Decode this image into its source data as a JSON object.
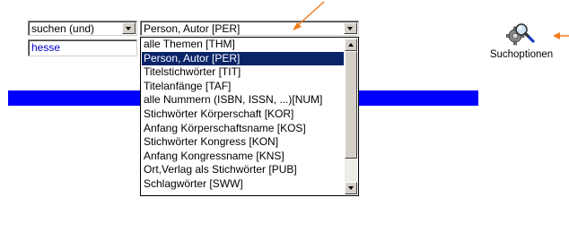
{
  "search_form": {
    "operator_select": {
      "selected": "suchen (und)"
    },
    "field_select": {
      "selected": "Person, Autor [PER]",
      "options": [
        "alle Themen [THM]",
        "Person, Autor [PER]",
        "Titelstichwörter [TIT]",
        "Titelanfänge [TAF]",
        "alle Nummern (ISBN, ISSN, ...)[NUM]",
        "Stichwörter Körperschaft [KOR]",
        "Anfang Körperschaftsname [KOS]",
        "Stichwörter Kongress [KON]",
        "Anfang Kongressname [KNS]",
        "Ort,Verlag als Stichwörter [PUB]",
        "Schlagwörter [SWW]"
      ],
      "highlighted_index": 1
    },
    "query_input": {
      "value": "hesse"
    }
  },
  "search_options": {
    "label": "Suchoptionen",
    "icon": "magnifier-gear-icon"
  },
  "colors": {
    "highlight": "#0a246a",
    "bar": "#0000ff",
    "annotation_arrow": "#f07c1c",
    "input_text": "#0000cc"
  }
}
